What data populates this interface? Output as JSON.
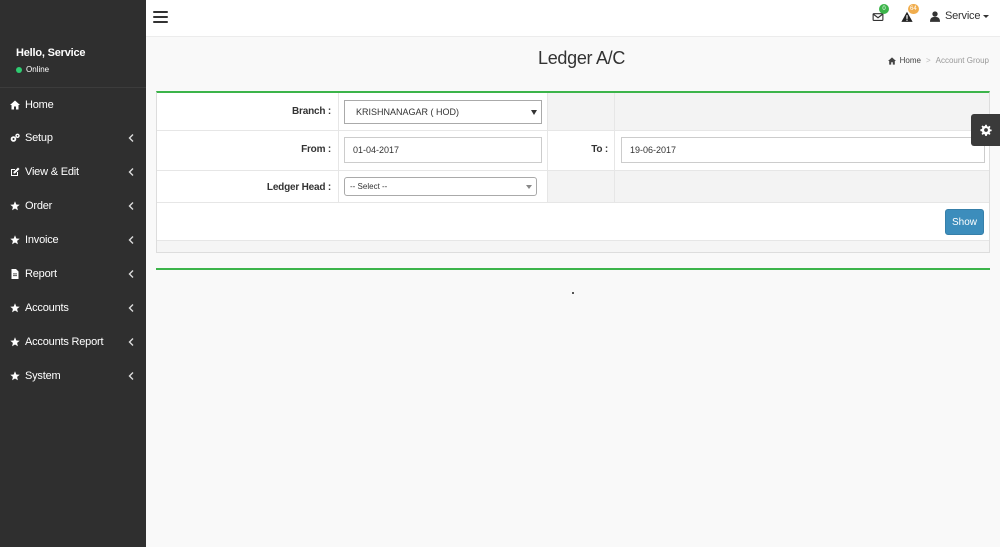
{
  "user": {
    "greeting": "Hello, Service",
    "status": "Online",
    "menu_label": "Service"
  },
  "sidebar": {
    "items": [
      {
        "label": "Home",
        "icon": "home-icon",
        "chevron": false
      },
      {
        "label": "Setup",
        "icon": "gears-icon",
        "chevron": true
      },
      {
        "label": "View & Edit",
        "icon": "edit-icon",
        "chevron": true
      },
      {
        "label": "Order",
        "icon": "star-icon",
        "chevron": true
      },
      {
        "label": "Invoice",
        "icon": "star-icon",
        "chevron": true
      },
      {
        "label": "Report",
        "icon": "file-icon",
        "chevron": true
      },
      {
        "label": "Accounts",
        "icon": "star-icon",
        "chevron": true
      },
      {
        "label": "Accounts Report",
        "icon": "star-icon",
        "chevron": true
      },
      {
        "label": "System",
        "icon": "star-icon",
        "chevron": true
      }
    ]
  },
  "header": {
    "messages_count": "0",
    "alerts_count": "64"
  },
  "page": {
    "title": "Ledger A/C",
    "breadcrumb": {
      "home": "Home",
      "current": "Account Group"
    }
  },
  "form": {
    "branch_label": "Branch :",
    "branch_value": "KRISHNANAGAR ( HOD)",
    "from_label": "From :",
    "from_value": "01-04-2017",
    "to_label": "To :",
    "to_value": "19-06-2017",
    "ledger_label": "Ledger Head :",
    "ledger_value": "-- Select --",
    "show_label": "Show"
  },
  "colors": {
    "sidebar": "#2f2f2f",
    "accent_green": "#3cb44a",
    "button_blue": "#3c8dbc",
    "badge_orange": "#f0ad4e"
  }
}
